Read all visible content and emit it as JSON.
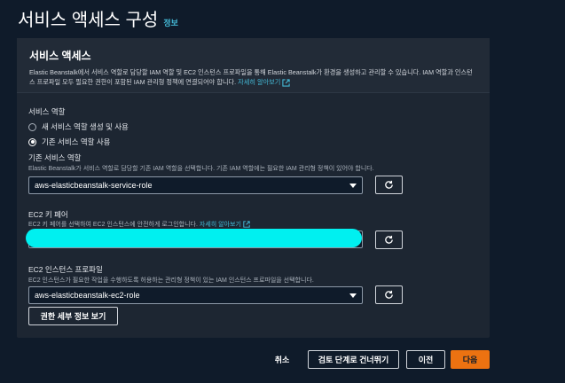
{
  "page": {
    "title": "서비스 액세스 구성",
    "info_link": "정보"
  },
  "panel": {
    "title": "서비스 액세스",
    "description": "Elastic Beanstalk에서 서비스 역할로 담당할 IAM 역할 및 EC2 인스턴스 프로파일을 통해 Elastic Beanstalk가 환경을 생성하고 관리할 수 있습니다. IAM 역할과 인스턴스 프로파일 모두 필요한 권한이 포함된 IAM 관리형 정책에 연결되어야 합니다.",
    "learn_more": "자세히 알아보기"
  },
  "service_role": {
    "label": "서비스 역할",
    "option_new": "새 서비스 역할 생성 및 사용",
    "option_existing": "기존 서비스 역할 사용",
    "selected_option": "option_existing"
  },
  "existing_service_role": {
    "label": "기존 서비스 역할",
    "description": "Elastic Beanstalk가 서비스 역할로 담당할 기존 IAM 역할을 선택합니다. 기존 IAM 역할에는 필요한 IAM 관리형 정책이 있어야 합니다.",
    "value": "aws-elasticbeanstalk-service-role"
  },
  "ec2_key_pair": {
    "label": "EC2 키 페어",
    "description": "EC2 키 페어를 선택하여 EC2 인스턴스에 안전하게 로그인합니다.",
    "learn_more": "자세히 알아보기"
  },
  "ec2_instance_profile": {
    "label": "EC2 인스턴스 프로파일",
    "description": "EC2 인스턴스가 필요한 작업을 수행하도록 허용하는 관리형 정책이 있는 IAM 인스턴스 프로파일을 선택합니다.",
    "value": "aws-elasticbeanstalk-ec2-role",
    "view_permissions": "권한 세부 정보 보기"
  },
  "footer": {
    "cancel": "취소",
    "skip_to_review": "검토 단계로 건너뛰기",
    "previous": "이전",
    "next": "다음"
  },
  "colors": {
    "background": "#0f1b2a",
    "panel": "#1d2632",
    "accent_link": "#44b9d6",
    "primary_button": "#ec7211",
    "redaction": "#00f0f0"
  }
}
